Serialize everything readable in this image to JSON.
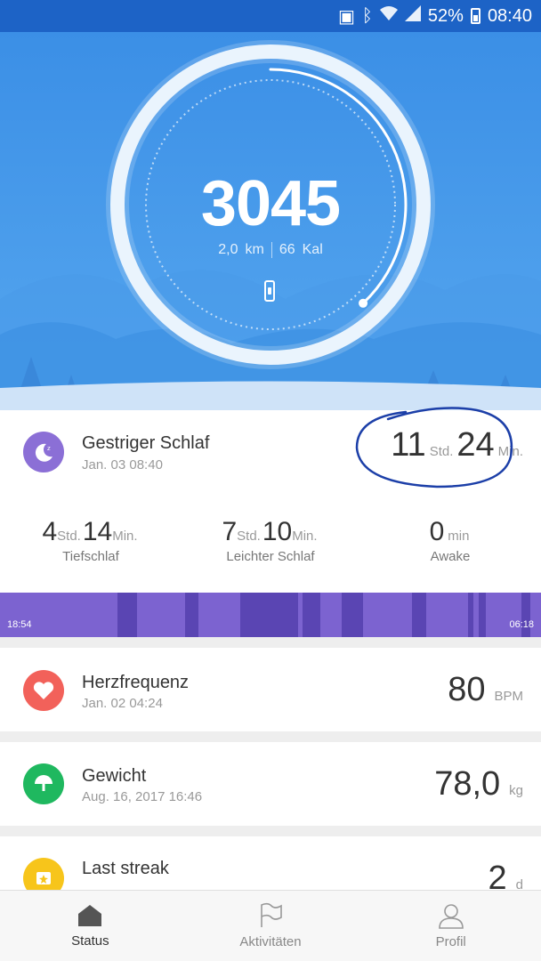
{
  "status_bar": {
    "battery": "52%",
    "time": "08:40"
  },
  "activity": {
    "steps": "3045",
    "distance_value": "2,0",
    "distance_unit": "km",
    "calories_value": "66",
    "calories_unit": "Kal",
    "goal_progress": 0.38
  },
  "sleep": {
    "title": "Gestriger Schlaf",
    "date": "Jan. 03 08:40",
    "total_hours": "11",
    "hours_unit": "Std.",
    "total_minutes": "24",
    "minutes_unit": "Min.",
    "deep": {
      "hours": "4",
      "hours_unit": "Std.",
      "minutes": "14",
      "minutes_unit": "Min.",
      "label": "Tiefschlaf"
    },
    "light": {
      "hours": "7",
      "hours_unit": "Std.",
      "minutes": "10",
      "minutes_unit": "Min.",
      "label": "Leichter Schlaf"
    },
    "awake": {
      "minutes": "0",
      "minutes_unit": "min",
      "label": "Awake"
    },
    "start_time": "18:54",
    "end_time": "06:18"
  },
  "heart_rate": {
    "title": "Herzfrequenz",
    "date": "Jan. 02 04:24",
    "value": "80",
    "unit": "BPM"
  },
  "weight": {
    "title": "Gewicht",
    "date": "Aug. 16, 2017 16:46",
    "value": "78,0",
    "unit": "kg"
  },
  "streak": {
    "title": "Last streak",
    "value": "2",
    "unit": "d"
  },
  "tabs": {
    "status": "Status",
    "activities": "Aktivitäten",
    "profile": "Profil"
  },
  "colors": {
    "sky": "#3b8fe6",
    "light_sleep": "#7c63d0",
    "deep_sleep": "#5a45b3",
    "heart": "#f2615a",
    "weight": "#1fb85f",
    "streak": "#f7c51b",
    "sleep_icon": "#8b6fd6",
    "annotation_ink": "#1c3fa8"
  }
}
